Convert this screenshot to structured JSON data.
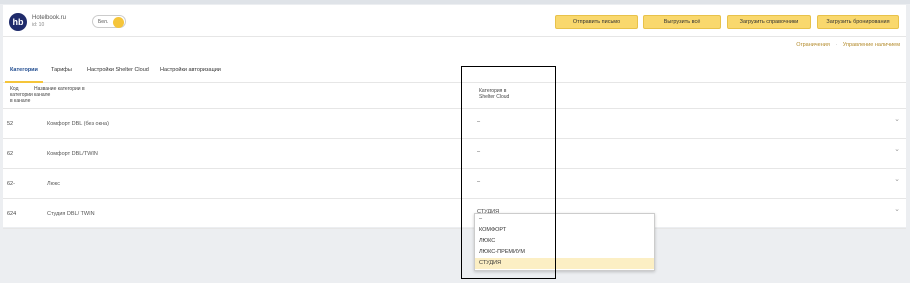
{
  "header": {
    "logo_text": "hb",
    "hotel_name": "Hotelbook.ru",
    "hotel_id": "id: 10",
    "lang_label": "Бел.",
    "buttons": [
      "Отправить письмо",
      "Выгрузить всё",
      "Загрузить справочники",
      "Загрузить бронирования"
    ]
  },
  "sublinks": [
    "Ограничения",
    "Управление наличием"
  ],
  "tabs": [
    "Категории",
    "Тарифы",
    "Настройки Shelter Cloud",
    "Настройки авторизации"
  ],
  "table": {
    "headers": {
      "code": [
        "Код",
        "категории",
        "в канале"
      ],
      "name": [
        "Название категории в",
        "канале"
      ],
      "shelter": [
        "Категория в",
        "Shelter Cloud"
      ]
    },
    "rows": [
      {
        "code": "52",
        "name": "Комфорт DBL (без окна)",
        "value": "–"
      },
      {
        "code": "62",
        "name": "Комфорт DBL/TWIN",
        "value": "–"
      },
      {
        "code": "62-",
        "name": "Люкс",
        "value": "–"
      },
      {
        "code": "624",
        "name": "Студия DBL/ TWIN",
        "value": "СТУДИЯ"
      }
    ]
  },
  "dropdown": {
    "options": [
      "–",
      "КОМФОРТ",
      "ЛЮКС",
      "ЛЮКС-ПРЕМИУМ",
      "СТУДИЯ"
    ],
    "selected": "СТУДИЯ"
  },
  "colors": {
    "accent": "#f9d86d",
    "logo": "#1f2b6b",
    "active_tab": "#1f4b8f",
    "link": "#b38a2a"
  }
}
